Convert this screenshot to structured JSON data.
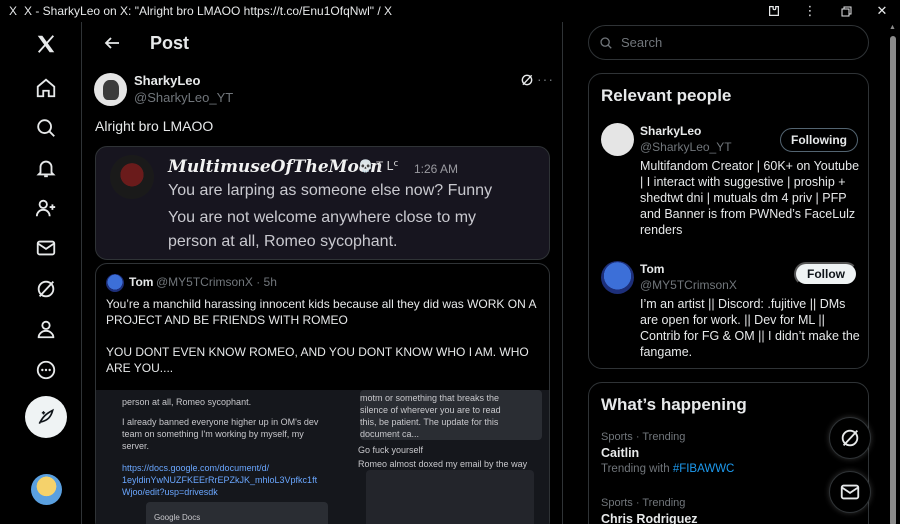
{
  "window": {
    "title": "X - SharkyLeo on X: \"Alright bro LMAOO https://t.co/Enu1OfqNwl\" / X",
    "app_icon": "x-logo"
  },
  "nav": {
    "items": [
      "home-icon",
      "explore-icon",
      "notifications-icon",
      "communities-icon",
      "messages-icon",
      "grok-icon",
      "profile-icon",
      "more-icon"
    ]
  },
  "header": {
    "title": "Post"
  },
  "post": {
    "author_name": "SharkyLeo",
    "author_handle": "@SharkyLeo_YT",
    "text": "Alright bro LMAOO",
    "more": "···"
  },
  "image_card": {
    "name": "MultimuseOfTheMoon",
    "badges": "💀 T ᒪᑦ",
    "time": "1:26 AM",
    "lines": [
      "You are larping as someone else now? Funny",
      "You are not welcome anywhere close to my",
      "person at all, Romeo sycophant."
    ]
  },
  "quote": {
    "name": "Tom",
    "handle": "@MY5TCrimsonX · 5h",
    "text": "You’re a manchild harassing innocent kids because all they did was WORK ON A PROJECT AND BE FRIENDS WITH ROMEO\n\nYOU DONT EVEN KNOW ROMEO, AND YOU DONT KNOW WHO I AM. WHO ARE YOU....",
    "shot_left": [
      "person at all, Romeo sycophant.",
      "I already banned everyone higher up in OM's dev",
      "team on something I'm working by myself, my",
      "server.",
      "https://docs.google.com/document/d/",
      "1eyldinYwNUZFKEErRrEPZkJK_mhloL3Vpfkc1ft",
      "Wjoo/edit?usp=drivesdk",
      "Google Docs"
    ],
    "shot_right": [
      "motm or something that breaks the",
      "silence of wherever you are to read",
      "this, be patient. The update for this",
      "document ca...",
      "Go fuck yourself",
      "Romeo almost doxed my email by the way"
    ]
  },
  "search": {
    "placeholder": "Search"
  },
  "relevant": {
    "title": "Relevant people",
    "people": [
      {
        "name": "SharkyLeo",
        "handle": "@SharkyLeo_YT",
        "button": "Following",
        "bio": "Multifandom Creator | 60K+ on Youtube | I interact with suggestive | proship + shedtwt dni | mutuals dm 4 priv | PFP and Banner is from PWNed’s FaceLulz renders"
      },
      {
        "name": "Tom",
        "handle": "@MY5TCrimsonX",
        "button": "Follow",
        "bio": "I’m an artist || Discord: .fujitive || DMs are open for work. || Dev for ML || Contrib for FG & OM || I didn’t make the fangame."
      }
    ]
  },
  "happening": {
    "title": "What’s happening",
    "trends": [
      {
        "meta": "Sports · Trending",
        "name": "Caitlin",
        "with_prefix": "Trending with",
        "with_tag": "#FIBAWWC"
      },
      {
        "meta": "Sports · Trending",
        "name": "Chris Rodriguez"
      }
    ]
  },
  "colors": {
    "accent": "#1d9bf0",
    "border": "#2f3336",
    "muted": "#71767b",
    "text": "#e7e9ea"
  }
}
